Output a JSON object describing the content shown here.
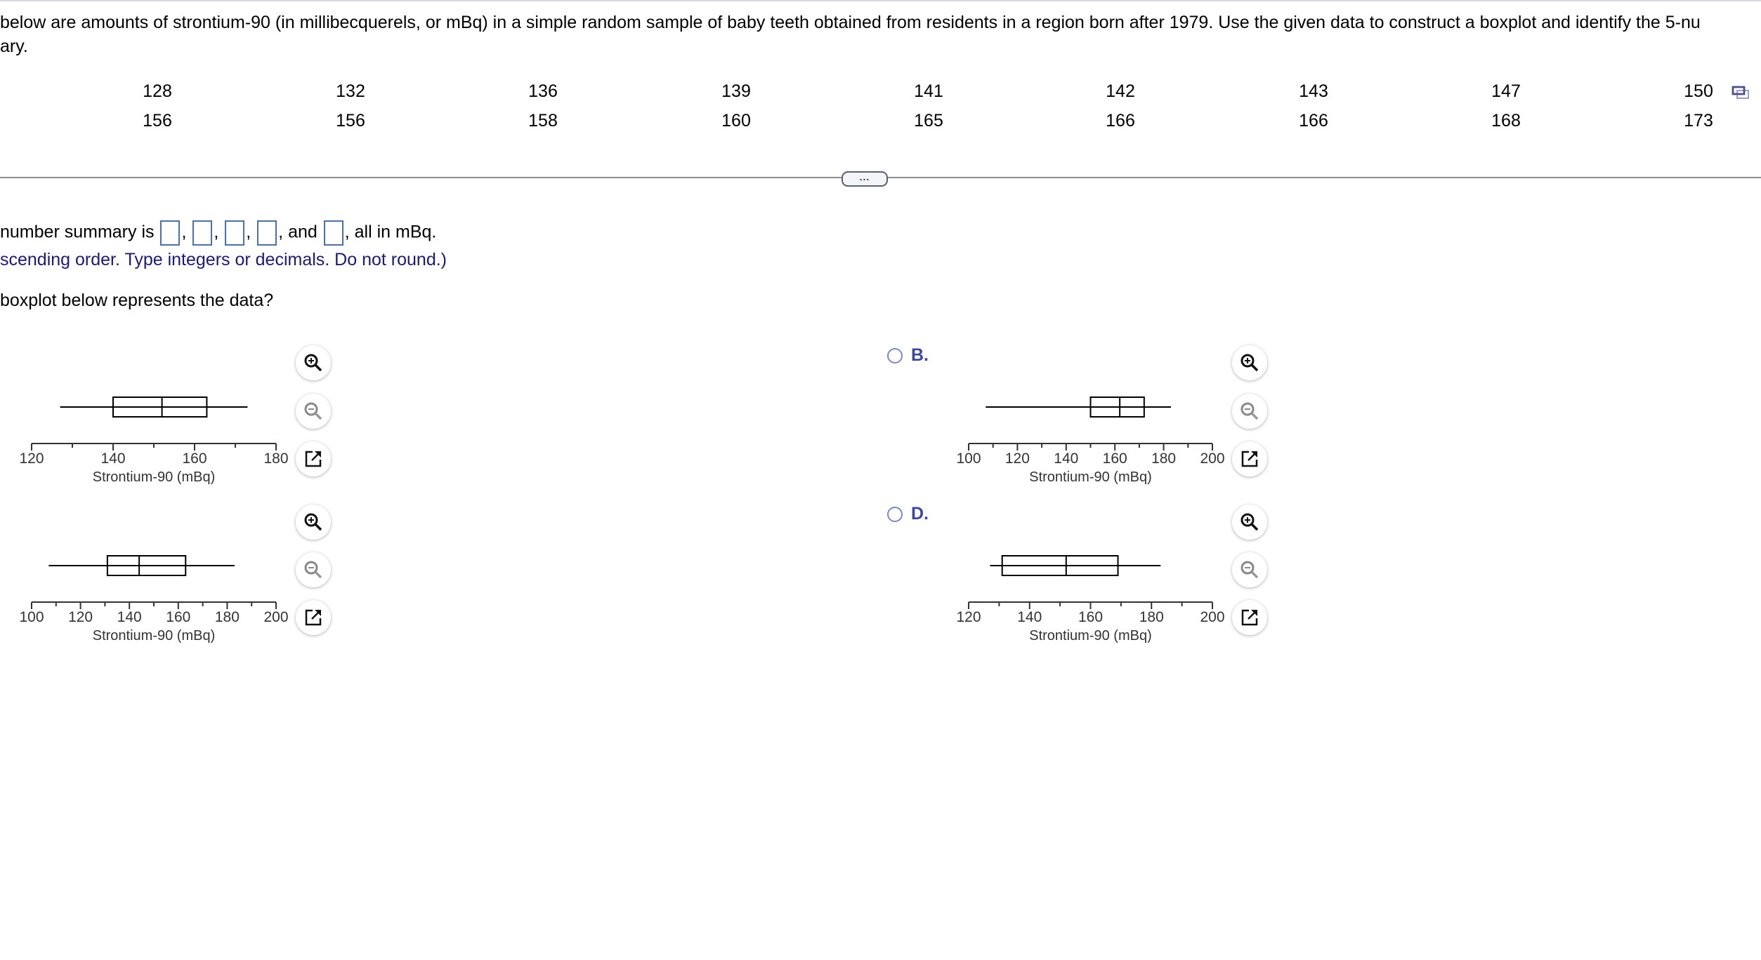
{
  "question": {
    "line1": "below are amounts of strontium-90 (in millibecquerels, or mBq) in a simple random sample of baby teeth obtained from residents in a region born after 1979. Use the given data to construct a boxplot and identify the 5-nu",
    "line2": "ary."
  },
  "data_table": {
    "rows": [
      [
        "128",
        "132",
        "136",
        "139",
        "141",
        "142",
        "143",
        "147",
        "150"
      ],
      [
        "156",
        "156",
        "158",
        "160",
        "165",
        "166",
        "166",
        "168",
        "173"
      ]
    ],
    "copy_icon": "copy-icon"
  },
  "more_button": "...",
  "summary": {
    "prefix": "number summary is",
    "sep": ",",
    "and": ", and",
    "suffix": ", all in mBq.",
    "inputs": [
      "",
      "",
      "",
      "",
      ""
    ],
    "hint": "scending order. Type integers or decimals. Do not round.)"
  },
  "boxplot_question": "boxplot below represents the data?",
  "options": [
    {
      "label": "",
      "selected": false
    },
    {
      "label": "B.",
      "selected": false
    },
    {
      "label": "",
      "selected": false
    },
    {
      "label": "D.",
      "selected": false
    }
  ],
  "colors": {
    "option_label": "#3b47a8",
    "hint": "#1a1a7a",
    "input_border": "#4a6fb5"
  },
  "chart_data": [
    {
      "type": "boxplot",
      "option": "A",
      "xlabel": "Strontium-90 (mBq)",
      "xlim": [
        120,
        180
      ],
      "ticks": [
        120,
        140,
        160,
        180
      ],
      "minor_step": 10,
      "min": 127,
      "q1": 140,
      "median": 152,
      "q3": 163,
      "max": 173
    },
    {
      "type": "boxplot",
      "option": "B",
      "xlabel": "Strontium-90 (mBq)",
      "xlim": [
        100,
        200
      ],
      "ticks": [
        100,
        120,
        140,
        160,
        180,
        200
      ],
      "minor_step": 10,
      "min": 107,
      "q1": 150,
      "median": 162,
      "q3": 172,
      "max": 183
    },
    {
      "type": "boxplot",
      "option": "C",
      "xlabel": "Strontium-90 (mBq)",
      "xlim": [
        100,
        200
      ],
      "ticks": [
        100,
        120,
        140,
        160,
        180,
        200
      ],
      "minor_step": 10,
      "min": 107,
      "q1": 131,
      "median": 144,
      "q3": 163,
      "max": 183
    },
    {
      "type": "boxplot",
      "option": "D",
      "xlabel": "Strontium-90 (mBq)",
      "xlim": [
        120,
        200
      ],
      "ticks": [
        120,
        140,
        160,
        180,
        200
      ],
      "minor_step": 10,
      "min": 127,
      "q1": 131,
      "median": 152,
      "q3": 169,
      "max": 183
    }
  ]
}
